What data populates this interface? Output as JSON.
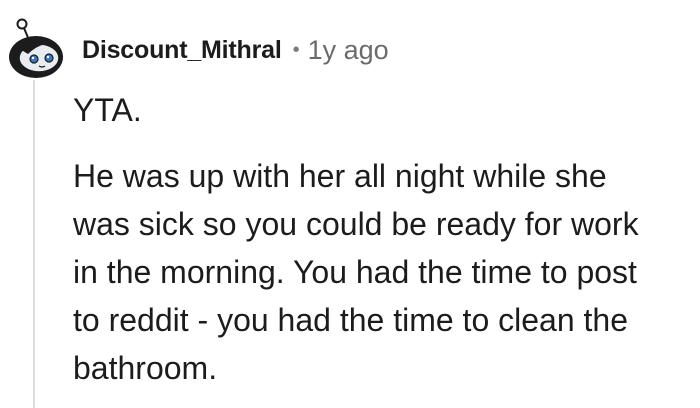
{
  "comment": {
    "author": "Discount_Mithral",
    "separator": "•",
    "age": "1y ago",
    "avatar_icon": "snoo-avatar-icon",
    "paragraphs": [
      {
        "lines": [
          "YTA."
        ]
      },
      {
        "lines": [
          "He was up with her all night while she",
          "was sick so you could be ready for work",
          "in the morning. You had the time to post",
          "to reddit - you had the time to clean the",
          "bathroom."
        ]
      }
    ]
  },
  "colors": {
    "thread_line": "#d9dee2",
    "text": "#1c1c1c",
    "meta": "#6b6b6b"
  }
}
